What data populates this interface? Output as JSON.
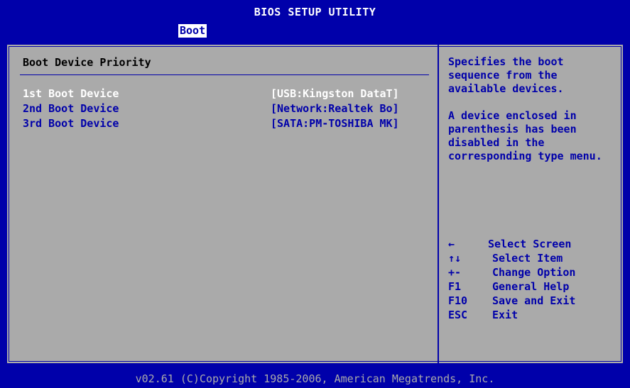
{
  "titlebar": {
    "title": "BIOS SETUP UTILITY"
  },
  "tabs": {
    "active": "Boot"
  },
  "section": {
    "title": "Boot Device Priority"
  },
  "boot_devices": [
    {
      "label": "1st Boot Device",
      "value": "[USB:Kingston DataT]",
      "selected": true
    },
    {
      "label": "2nd Boot Device",
      "value": "[Network:Realtek Bo]",
      "selected": false
    },
    {
      "label": "3rd Boot Device",
      "value": "[SATA:PM-TOSHIBA MK]",
      "selected": false
    }
  ],
  "help": {
    "p1": "Specifies the boot sequence from the available devices.",
    "p2": "A device enclosed in parenthesis has been disabled in the corresponding type menu."
  },
  "keys": [
    {
      "key": "←",
      "desc": "Select Screen"
    },
    {
      "key": "↑↓",
      "desc": "Select Item"
    },
    {
      "key": "+-",
      "desc": "Change Option"
    },
    {
      "key": "F1",
      "desc": "General Help"
    },
    {
      "key": "F10",
      "desc": "Save and Exit"
    },
    {
      "key": "ESC",
      "desc": "Exit"
    }
  ],
  "footer": {
    "copyright": "v02.61 (C)Copyright 1985-2006, American Megatrends, Inc."
  },
  "colors": {
    "background": "#0000aa",
    "panel": "#aaaaaa",
    "highlight_text": "#ffffff",
    "normal_text": "#0000aa"
  }
}
